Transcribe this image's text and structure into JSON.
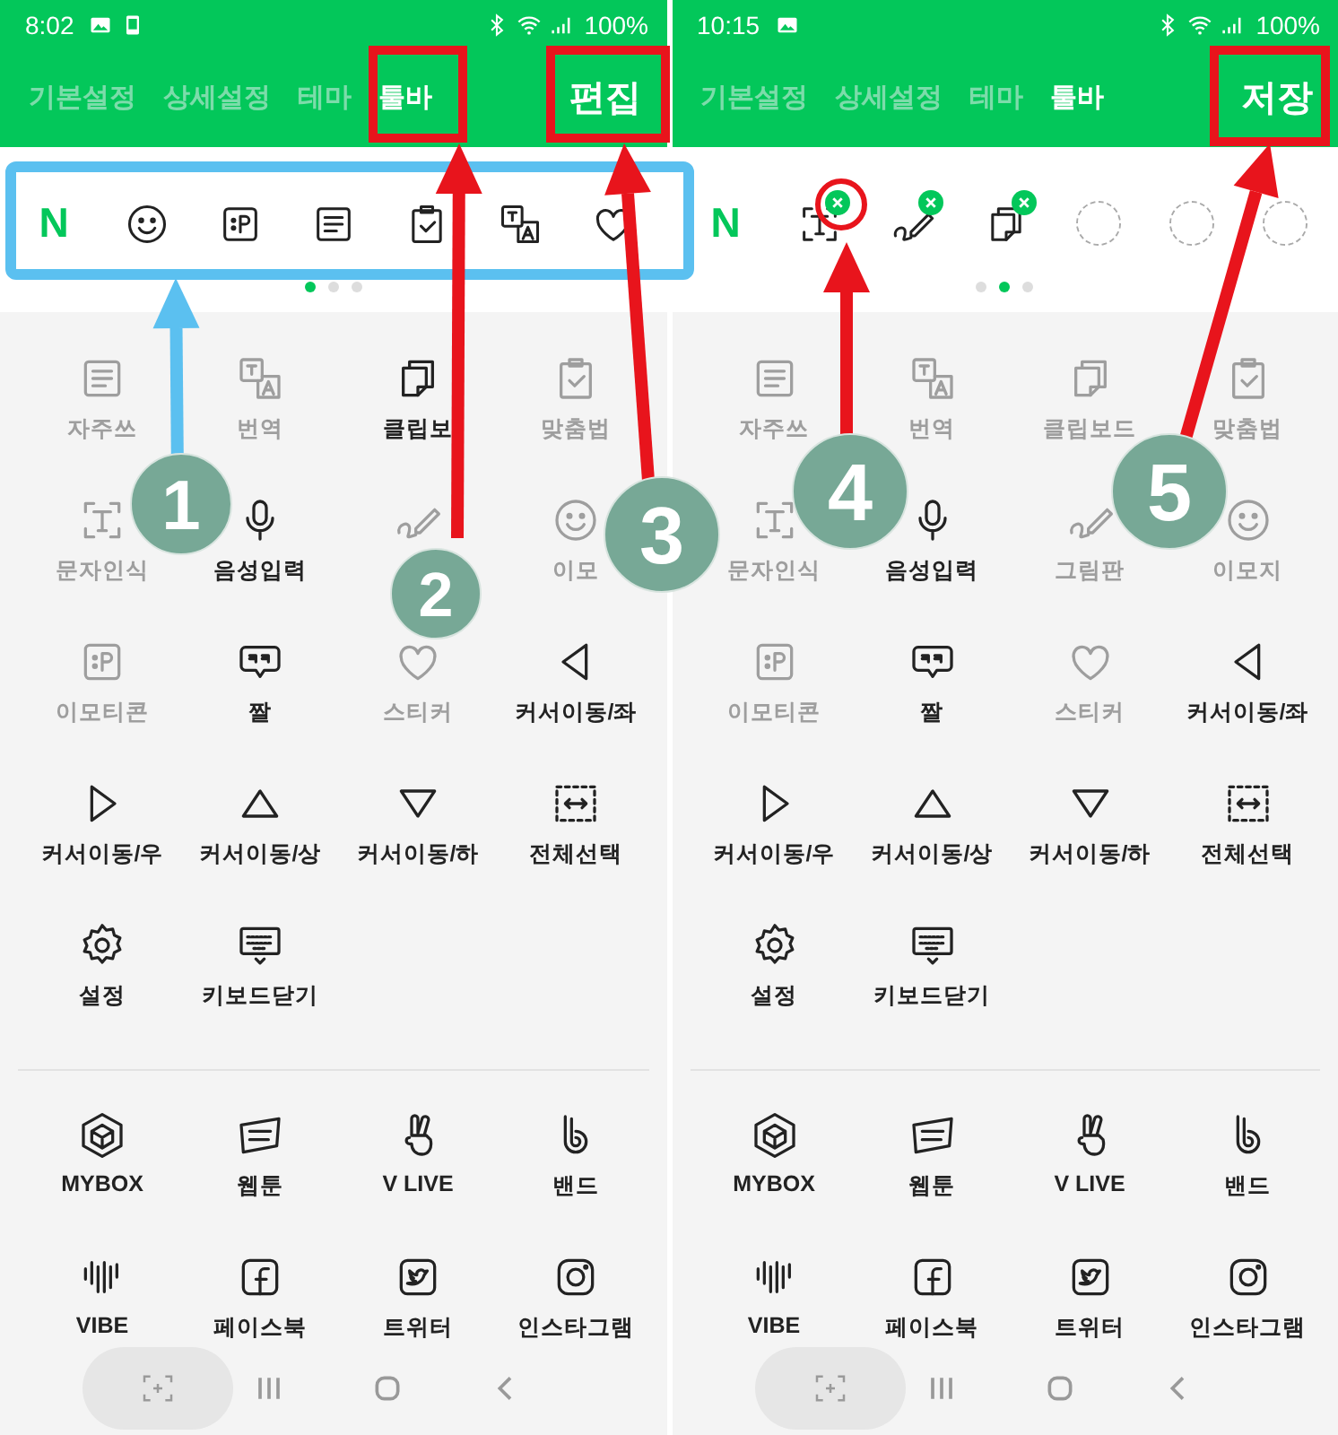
{
  "panels": [
    {
      "status_bar": {
        "time": "8:02",
        "battery": "100%"
      },
      "tabs": [
        {
          "label": "기본설정",
          "selected": false
        },
        {
          "label": "상세설정",
          "selected": false
        },
        {
          "label": "테마",
          "selected": false
        },
        {
          "label": "툴바",
          "selected": true
        }
      ],
      "action": "편집",
      "toolbar": [
        {
          "kind": "logo",
          "text": "N"
        },
        {
          "kind": "tool"
        },
        {
          "kind": "tool"
        },
        {
          "kind": "tool"
        },
        {
          "kind": "tool"
        },
        {
          "kind": "tool"
        },
        {
          "kind": "tool"
        }
      ],
      "pages": [
        {
          "selected": true
        },
        {
          "selected": false
        },
        {
          "selected": false
        }
      ],
      "tools": [
        {
          "label": "자주쓰",
          "enabled": false
        },
        {
          "label": "번역",
          "enabled": false
        },
        {
          "label": "클립보",
          "enabled": true
        },
        {
          "label": "맞춤법",
          "enabled": false
        },
        {
          "label": "문자인식",
          "enabled": false
        },
        {
          "label": "음성입력",
          "enabled": true
        },
        {
          "enabled": false
        },
        {
          "label": "이모",
          "enabled": false
        },
        {
          "label": "이모티콘",
          "enabled": false
        },
        {
          "label": "짤",
          "enabled": true
        },
        {
          "label": "스티커",
          "enabled": false
        },
        {
          "label": "커서이동/좌",
          "enabled": true
        },
        {
          "label": "커서이동/우",
          "enabled": true
        },
        {
          "label": "커서이동/상",
          "enabled": true
        },
        {
          "label": "커서이동/하",
          "enabled": true
        },
        {
          "label": "전체선택",
          "enabled": true
        },
        {
          "label": "설정",
          "enabled": true
        },
        {
          "label": "키보드닫기",
          "enabled": true
        }
      ],
      "apps": [
        "MYBOX",
        "웹툰",
        "V LIVE",
        "밴드",
        "VIBE",
        "페이스북",
        "트위터",
        "인스타그램"
      ]
    },
    {
      "status_bar": {
        "time": "10:15",
        "battery": "100%"
      },
      "tabs": [
        {
          "label": "기본설정",
          "selected": false
        },
        {
          "label": "상세설정",
          "selected": false
        },
        {
          "label": "테마",
          "selected": false
        },
        {
          "label": "툴바",
          "selected": true
        }
      ],
      "action": "저장",
      "toolbar": [
        {
          "kind": "logo",
          "text": "N"
        },
        {
          "kind": "tool",
          "removable": true
        },
        {
          "kind": "tool",
          "removable": true
        },
        {
          "kind": "tool",
          "removable": true
        },
        {
          "kind": "empty"
        },
        {
          "kind": "empty"
        },
        {
          "kind": "empty"
        }
      ],
      "pages": [
        {
          "selected": false
        },
        {
          "selected": true
        },
        {
          "selected": false
        }
      ],
      "tools": [
        {
          "label": "자주쓰",
          "enabled": false
        },
        {
          "label": "번역",
          "enabled": false
        },
        {
          "label": "클립보드",
          "enabled": false
        },
        {
          "label": "맞춤법",
          "enabled": false
        },
        {
          "label": "문자인식",
          "enabled": false
        },
        {
          "label": "음성입력",
          "enabled": true
        },
        {
          "label": "그림판",
          "enabled": false
        },
        {
          "label": "이모지",
          "enabled": false
        },
        {
          "label": "이모티콘",
          "enabled": false
        },
        {
          "label": "짤",
          "enabled": true
        },
        {
          "label": "스티커",
          "enabled": false
        },
        {
          "label": "커서이동/좌",
          "enabled": true
        },
        {
          "label": "커서이동/우",
          "enabled": true
        },
        {
          "label": "커서이동/상",
          "enabled": true
        },
        {
          "label": "커서이동/하",
          "enabled": true
        },
        {
          "label": "전체선택",
          "enabled": true
        },
        {
          "label": "설정",
          "enabled": true
        },
        {
          "label": "키보드닫기",
          "enabled": true
        }
      ],
      "apps": [
        "MYBOX",
        "웹툰",
        "V LIVE",
        "밴드",
        "VIBE",
        "페이스북",
        "트위터",
        "인스타그램"
      ]
    }
  ],
  "steps": [
    {
      "number": "1"
    },
    {
      "number": "2"
    },
    {
      "number": "3"
    },
    {
      "number": "4"
    },
    {
      "number": "5"
    }
  ]
}
